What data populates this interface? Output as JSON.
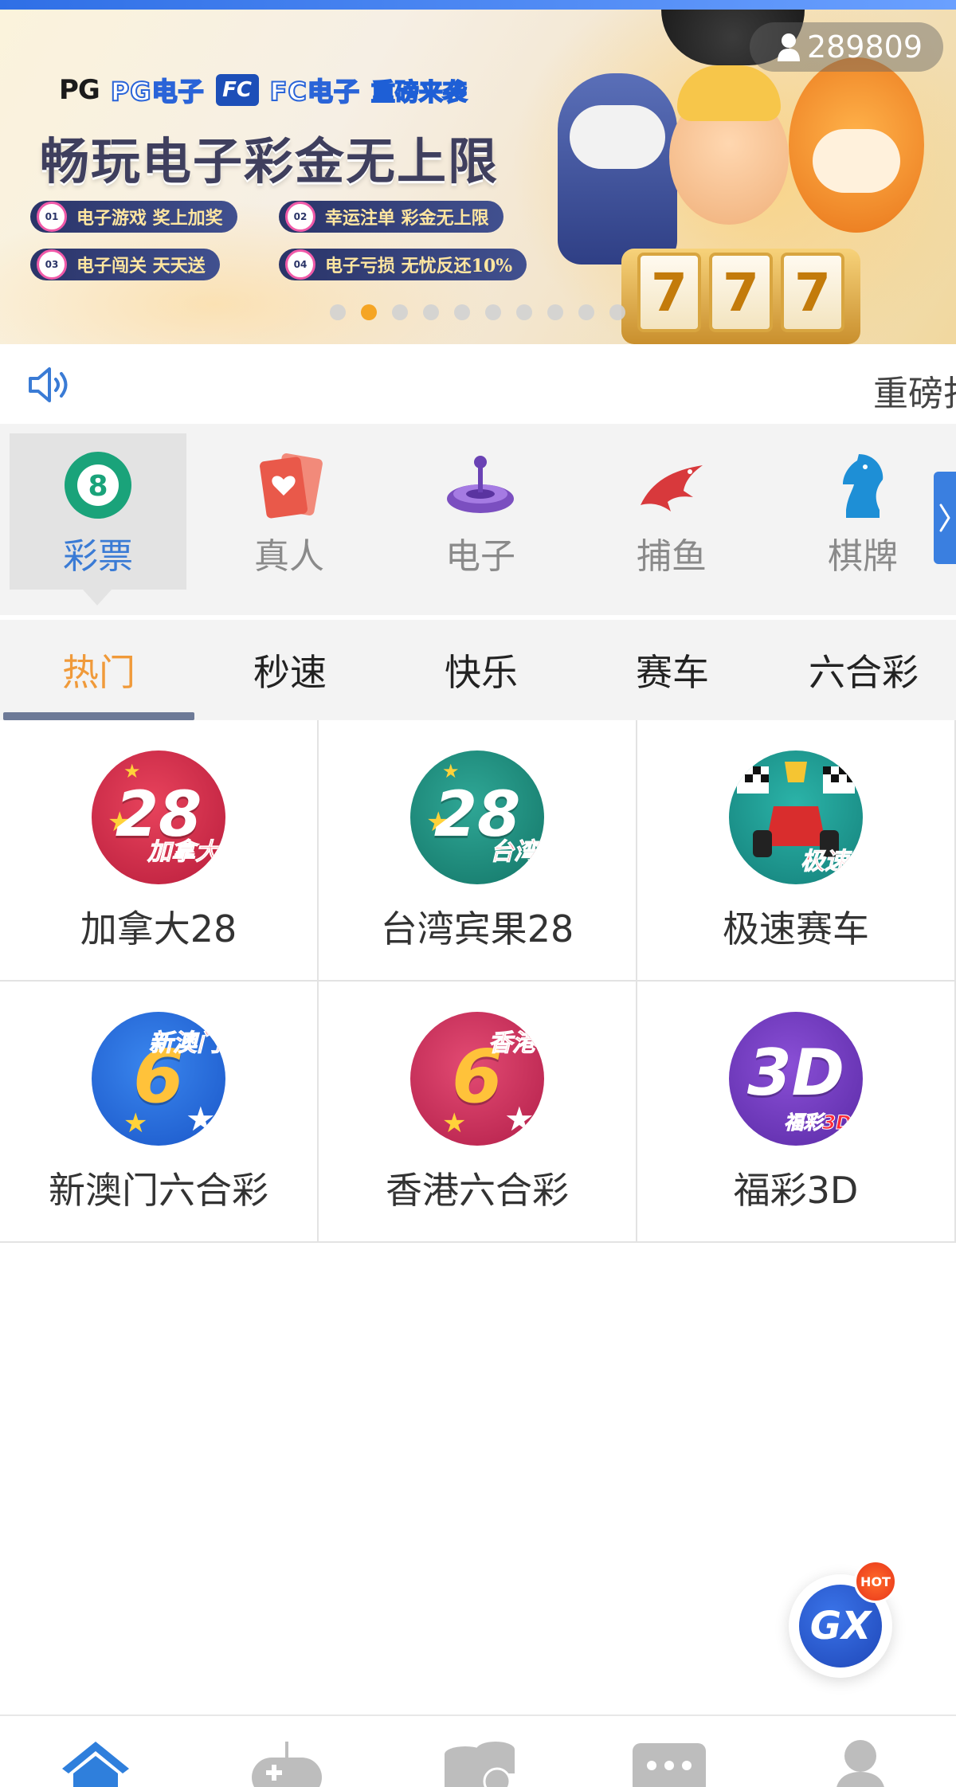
{
  "banner": {
    "brand_pg": "PG",
    "brand_pg_label": "PG电子",
    "brand_fc_logo": "FC",
    "brand_fc_label": "FC电子",
    "brand_tag": "重磅来袭",
    "title": "畅玩电子彩金无上限",
    "promos": [
      {
        "num": "01",
        "text": "电子游戏 奖上加奖"
      },
      {
        "num": "02",
        "text": "幸运注单 彩金无上限"
      },
      {
        "num": "03",
        "text": "电子闯关 天天送"
      },
      {
        "num": "04",
        "text": "电子亏损 无忧反还10%"
      }
    ],
    "reels": [
      "7",
      "7",
      "7"
    ],
    "slide_count": 10,
    "active_slide": 2
  },
  "user": {
    "id": "289809",
    "icon": "user-icon"
  },
  "notice": {
    "icon": "speaker-icon",
    "text": "重磅打"
  },
  "categories": [
    {
      "label": "彩票",
      "icon": "lottery-ball-icon",
      "active": true
    },
    {
      "label": "真人",
      "icon": "cards-icon",
      "active": false
    },
    {
      "label": "电子",
      "icon": "slot-machine-icon",
      "active": false
    },
    {
      "label": "捕鱼",
      "icon": "shark-icon",
      "active": false
    },
    {
      "label": "棋牌",
      "icon": "chess-knight-icon",
      "active": false
    }
  ],
  "tabs": [
    {
      "label": "热门",
      "active": true
    },
    {
      "label": "秒速",
      "active": false
    },
    {
      "label": "快乐",
      "active": false
    },
    {
      "label": "赛车",
      "active": false
    },
    {
      "label": "六合彩",
      "active": false
    }
  ],
  "games": [
    {
      "name": "加拿大28",
      "badge": "28",
      "tag": "加拿大"
    },
    {
      "name": "台湾宾果28",
      "badge": "28",
      "tag": "台湾"
    },
    {
      "name": "极速赛车",
      "badge": "",
      "tag": "极速"
    },
    {
      "name": "新澳门六合彩",
      "badge": "6",
      "tag": "新澳门"
    },
    {
      "name": "香港六合彩",
      "badge": "6",
      "tag": "香港"
    },
    {
      "name": "福彩3D",
      "badge": "3D",
      "tag": "福彩3D"
    }
  ],
  "fab": {
    "label": "GX",
    "hot": "HOT"
  },
  "bottom_nav": [
    {
      "icon": "home-icon",
      "active": true
    },
    {
      "icon": "gamepad-icon",
      "active": false
    },
    {
      "icon": "coins-icon",
      "active": false
    },
    {
      "icon": "chat-icon",
      "active": false
    },
    {
      "icon": "profile-icon",
      "active": false
    }
  ],
  "colors": {
    "accent": "#3a7bd5",
    "tab_active": "#f09a3a",
    "dot_active": "#f5a524"
  }
}
